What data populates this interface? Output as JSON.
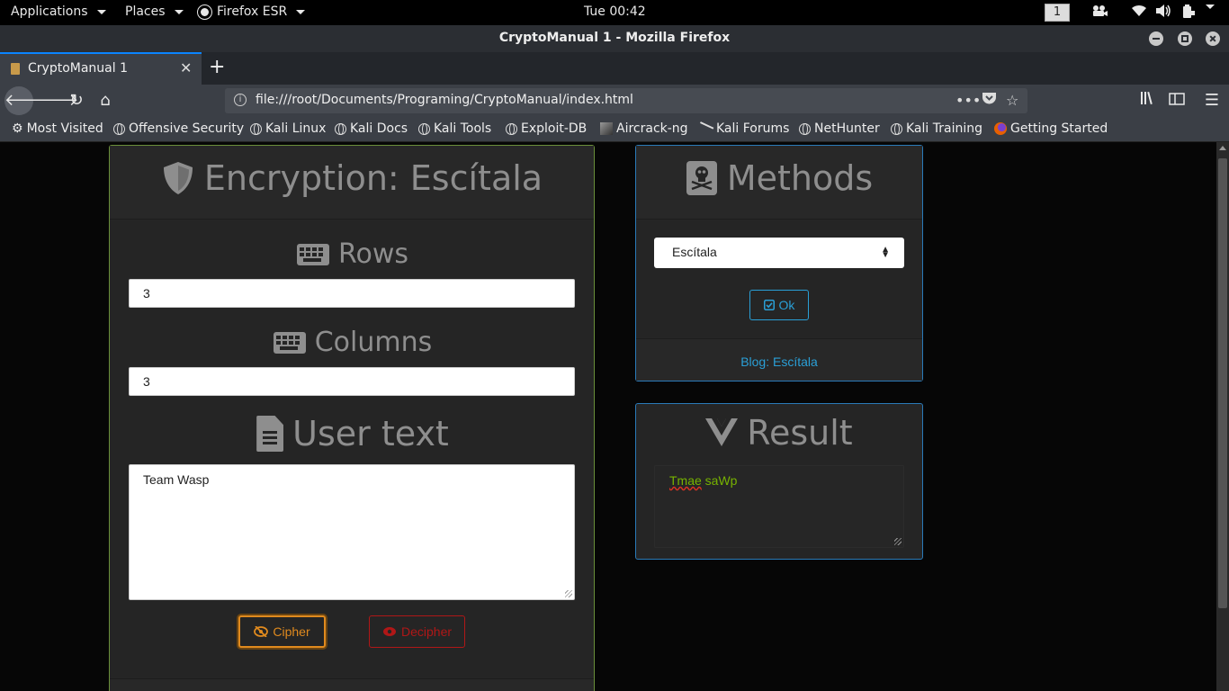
{
  "topbar": {
    "applications": "Applications",
    "places": "Places",
    "firefox_menu": "Firefox ESR",
    "clock": "Tue 00:42",
    "workspace": "1"
  },
  "window": {
    "title": "CryptoManual 1 - Mozilla Firefox"
  },
  "tabs": [
    {
      "label": "CryptoManual 1",
      "active": true
    }
  ],
  "urlbar": {
    "url": "file:///root/Documents/Programing/CryptoManual/index.html"
  },
  "bookmarks": [
    {
      "label": "Most Visited",
      "icon": "gear-icon"
    },
    {
      "label": "Offensive Security",
      "icon": "globe-icon"
    },
    {
      "label": "Kali Linux",
      "icon": "globe-icon"
    },
    {
      "label": "Kali Docs",
      "icon": "globe-icon"
    },
    {
      "label": "Kali Tools",
      "icon": "globe-icon"
    },
    {
      "label": "Exploit-DB",
      "icon": "globe-icon"
    },
    {
      "label": "Aircrack-ng",
      "icon": "aircrack-icon"
    },
    {
      "label": "Kali Forums",
      "icon": "kali-dragon-icon"
    },
    {
      "label": "NetHunter",
      "icon": "globe-icon"
    },
    {
      "label": "Kali Training",
      "icon": "globe-icon"
    },
    {
      "label": "Getting Started",
      "icon": "firefox-icon"
    }
  ],
  "encryption": {
    "title": "Encryption: Escítala",
    "rows_label": "Rows",
    "rows_value": "3",
    "columns_label": "Columns",
    "columns_value": "3",
    "user_text_label": "User text",
    "user_text_value": "Team Wasp",
    "cipher_button": "Cipher",
    "decipher_button": "Decipher"
  },
  "methods": {
    "title": "Methods",
    "selected": "Escítala",
    "ok_button": "Ok",
    "blog_link": "Blog: Escítala"
  },
  "result": {
    "title": "Result",
    "value": "Tmae saWp"
  },
  "colors": {
    "success_border": "#6a8f3a",
    "info_border": "#2a7ab8",
    "cipher_orange": "#e08a1e",
    "decipher_red": "#b01717",
    "link_blue": "#2a9fd6",
    "result_green": "#77b300"
  }
}
